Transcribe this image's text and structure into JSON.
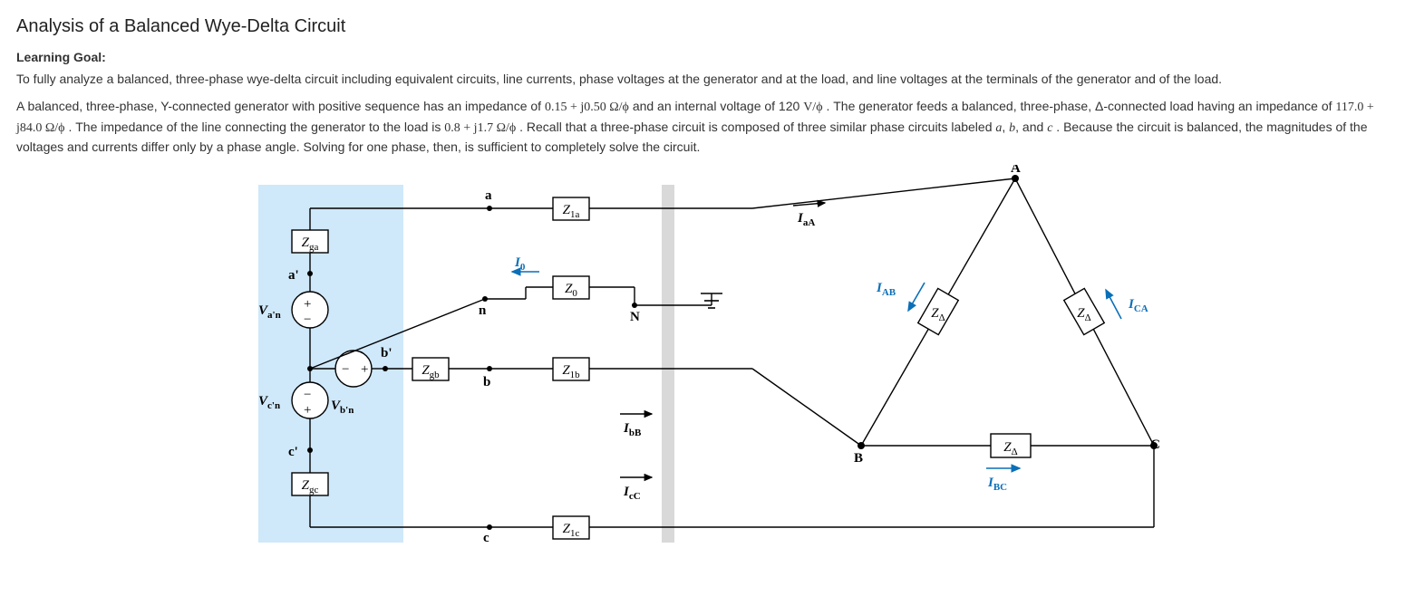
{
  "title": "Analysis of a Balanced Wye-Delta Circuit",
  "learning_goal_label": "Learning Goal:",
  "learning_goal_body": "To fully analyze a balanced, three-phase wye-delta circuit including equivalent circuits, line currents, phase voltages at the generator and at the load, and line voltages at the terminals of the generator and of the load.",
  "problem_prefix": "A balanced, three-phase, Y-connected generator with positive sequence has an impedance of ",
  "gen_impedance": "0.15 + j0.50 Ω/ϕ",
  "problem_mid1": " and an internal voltage of 120 ",
  "gen_voltage_unit": "V/ϕ",
  "problem_mid2": " . The generator feeds a balanced, three-phase, Δ-connected load having an impedance of ",
  "load_impedance": "117.0 + j84.0 Ω/ϕ",
  "problem_mid3": " . The impedance of the line connecting the generator to the load is ",
  "line_impedance": "0.8 + j1.7 Ω/ϕ",
  "problem_mid4": " . Recall that a three-phase circuit is composed of three similar phase circuits labeled ",
  "phase_a": "a",
  "phase_b": "b",
  "phase_c": "c",
  "problem_suffix": ". Because the circuit is balanced, the magnitudes of the voltages and currents differ only by a phase angle. Solving for one phase, then, is sufficient to completely solve the circuit.",
  "diagram": {
    "Zga": "Zga",
    "Zgb": "Zgb",
    "Zgc": "Zgc",
    "Zla": "Z1a",
    "Zlb": "Z1b",
    "Zlc": "Z1c",
    "Z0": "Z0",
    "Zdelta": "ZΔ",
    "Van": "Va'n",
    "Vbn": "Vb'n",
    "Vcn": "Vc'n",
    "a": "a",
    "b": "b",
    "c": "c",
    "n": "n",
    "N": "N",
    "ap": "a'",
    "bp": "b'",
    "cp": "c'",
    "A": "A",
    "B": "B",
    "C": "C",
    "IaA": "IaA",
    "IbB": "IbB",
    "IcC": "IcC",
    "IAB": "IAB",
    "IBC": "IBC",
    "ICA": "ICA",
    "I0": "I0"
  }
}
